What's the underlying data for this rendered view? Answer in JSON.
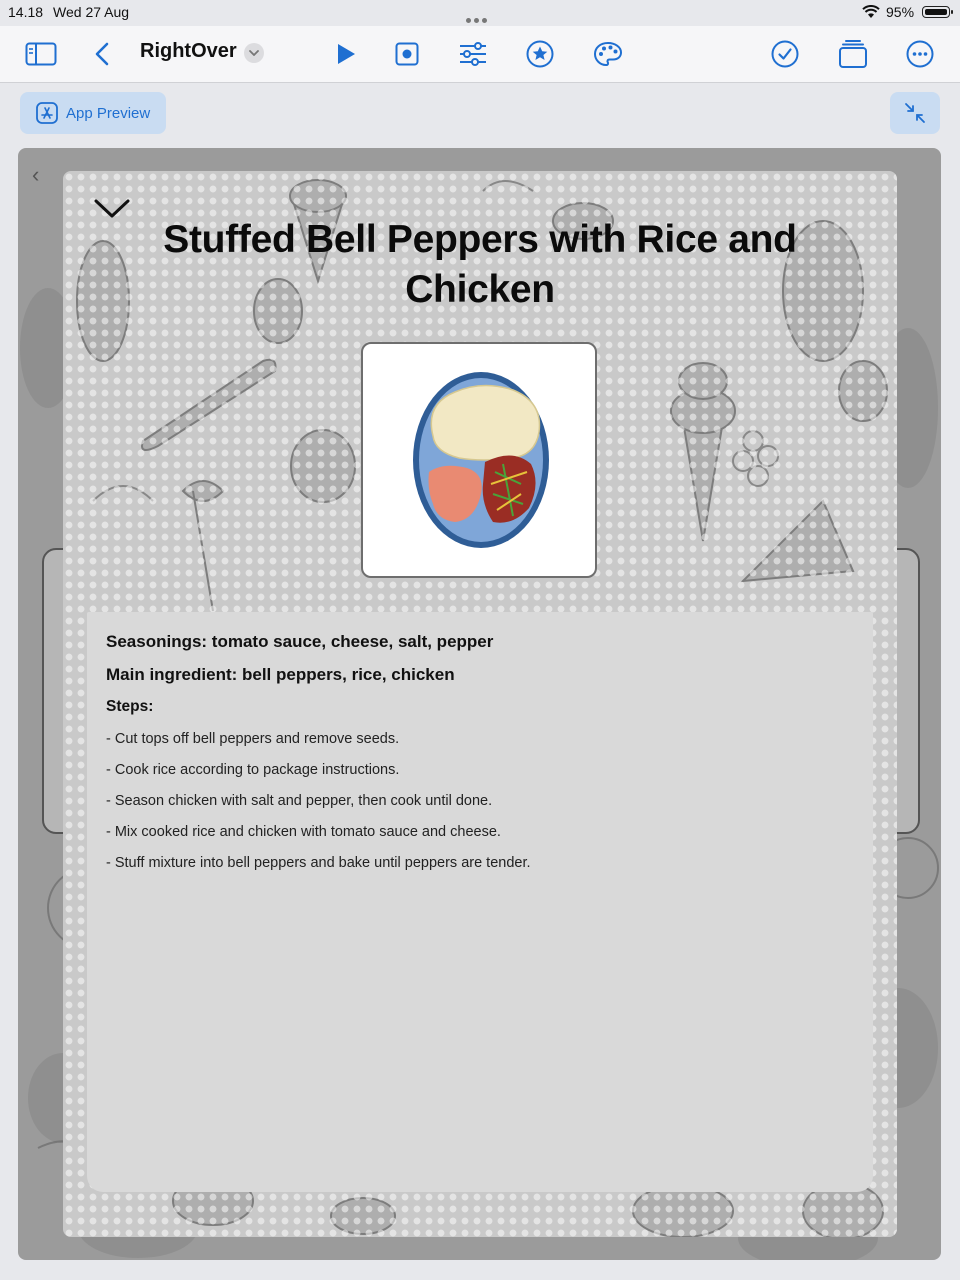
{
  "status": {
    "time": "14.18",
    "date": "Wed 27 Aug",
    "battery": "95%"
  },
  "toolbar": {
    "app_name": "RightOver"
  },
  "preview": {
    "label": "App Preview"
  },
  "recipe": {
    "title": "Stuffed Bell Peppers with Rice and Chicken",
    "seasonings": "Seasonings: tomato sauce, cheese, salt, pepper",
    "main_ingredient": "Main ingredient: bell peppers, rice, chicken",
    "steps_label": "Steps:",
    "steps": [
      "- Cut tops off bell peppers and remove seeds.",
      "- Cook rice according to package instructions.",
      "- Season chicken with salt and pepper, then cook until done.",
      "- Mix cooked rice and chicken with tomato sauce and cheese.",
      "- Stuff mixture into bell peppers and bake until peppers are tender."
    ]
  },
  "colors": {
    "accent": "#1f6fd1",
    "sheet_panel": "#d9d9d9",
    "plate_rim": "#2f5d96",
    "plate_inner": "#7fa6d8"
  }
}
